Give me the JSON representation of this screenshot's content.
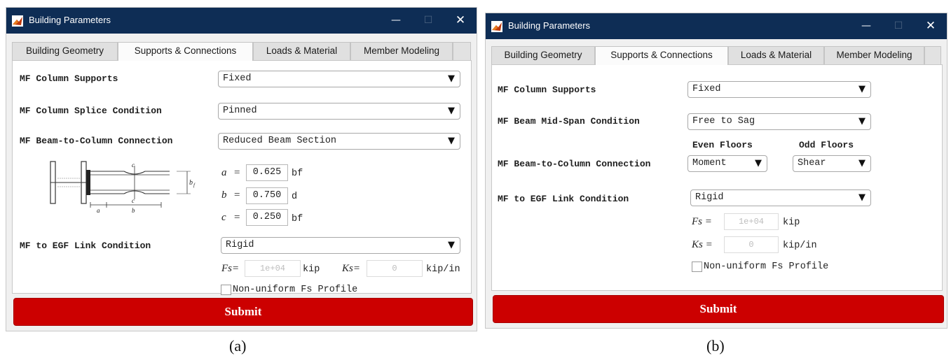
{
  "window_a": {
    "title": "Building Parameters",
    "tabs": [
      "Building Geometry",
      "Supports & Connections",
      "Loads & Material",
      "Member Modeling"
    ],
    "rows": {
      "col_supports": {
        "label": "MF Column Supports",
        "value": "Fixed"
      },
      "splice": {
        "label": "MF Column Splice Condition",
        "value": "Pinned"
      },
      "connection": {
        "label": "MF Beam-to-Column Connection",
        "value": "Reduced Beam Section"
      },
      "link": {
        "label": "MF to EGF Link Condition",
        "value": "Rigid"
      }
    },
    "rbs": {
      "a": {
        "var": "a",
        "eq": "=",
        "value": "0.625",
        "unit": "bf"
      },
      "b": {
        "var": "b",
        "eq": "=",
        "value": "0.750",
        "unit": "d"
      },
      "c": {
        "var": "c",
        "eq": "=",
        "value": "0.250",
        "unit": "bf"
      },
      "diagram_labels": {
        "a": "a",
        "b": "b",
        "c_top": "c",
        "c_bot": "c",
        "bf": "b",
        "bf_sub": "f"
      }
    },
    "fs": {
      "var": "Fs=",
      "value": "1e+04",
      "unit": "kip"
    },
    "ks": {
      "var": "Ks=",
      "value": "0",
      "unit": "kip/in"
    },
    "checkbox": "Non-uniform Fs Profile",
    "submit": "Submit"
  },
  "window_b": {
    "title": "Building Parameters",
    "tabs": [
      "Building Geometry",
      "Supports & Connections",
      "Loads & Material",
      "Member Modeling"
    ],
    "rows": {
      "col_supports": {
        "label": "MF Column Supports",
        "value": "Fixed"
      },
      "midspan": {
        "label": "MF Beam Mid-Span Condition",
        "value": "Free to Sag"
      },
      "connection": {
        "label": "MF Beam-to-Column Connection",
        "even_header": "Even Floors",
        "odd_header": "Odd Floors",
        "even_value": "Moment",
        "odd_value": "Shear"
      },
      "link": {
        "label": "MF to EGF Link Condition",
        "value": "Rigid"
      }
    },
    "fs": {
      "var": "Fs =",
      "value": "1e+04",
      "unit": "kip"
    },
    "ks": {
      "var": "Ks =",
      "value": "0",
      "unit": "kip/in"
    },
    "checkbox": "Non-uniform Fs Profile",
    "submit": "Submit"
  },
  "sublabels": {
    "a": "(a)",
    "b": "(b)"
  },
  "icons": {
    "minimize": "—",
    "maximize": "☐",
    "close": "✕",
    "dropdown": "▼"
  },
  "colors": {
    "titlebar": "#0e2d55",
    "submit": "#cc0000",
    "panel": "#ffffff"
  }
}
